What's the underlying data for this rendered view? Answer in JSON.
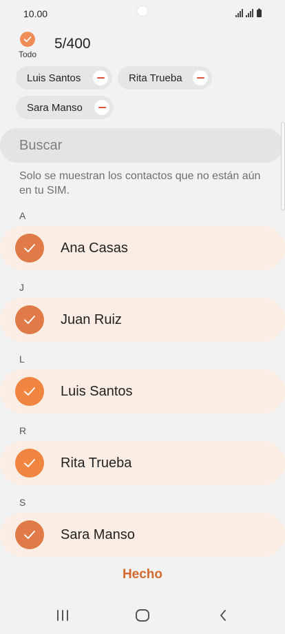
{
  "status_bar": {
    "time": "10.00"
  },
  "header": {
    "select_all_label": "Todo",
    "count": "5/400"
  },
  "chips": [
    {
      "label": "Luis Santos"
    },
    {
      "label": "Rita Trueba"
    },
    {
      "label": "Sara Manso"
    }
  ],
  "search": {
    "placeholder": "Buscar"
  },
  "notice": "Solo se muestran los contactos que no están aún en tu SIM.",
  "sections": [
    {
      "letter": "A",
      "contact": "Ana Casas"
    },
    {
      "letter": "J",
      "contact": "Juan Ruiz"
    },
    {
      "letter": "L",
      "contact": "Luis Santos"
    },
    {
      "letter": "R",
      "contact": "Rita Trueba"
    },
    {
      "letter": "S",
      "contact": "Sara Manso"
    }
  ],
  "footer": {
    "done_label": "Hecho"
  },
  "colors": {
    "accent": "#f08c55",
    "done_text": "#d2692e",
    "row_background": "#fbede4",
    "check_circle": "#e07a48"
  },
  "icons": {
    "nav_recents": "recents-icon",
    "nav_home": "home-icon",
    "nav_back": "back-icon"
  }
}
